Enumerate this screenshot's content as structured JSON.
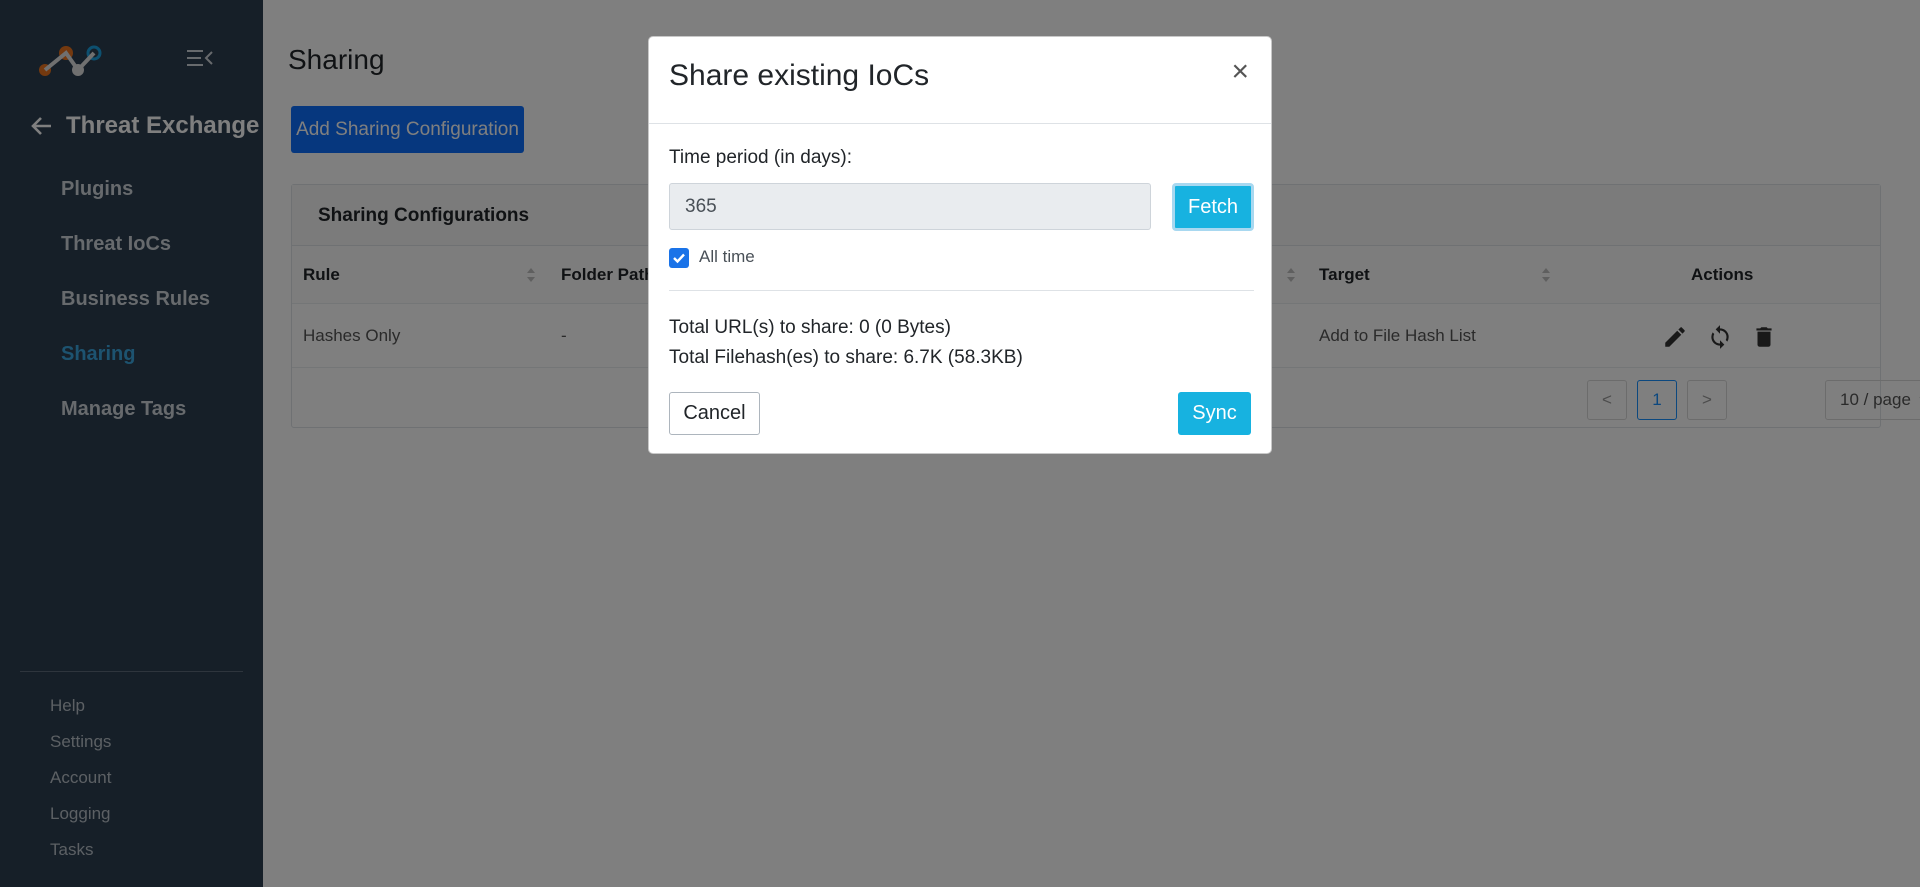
{
  "sidebar": {
    "module_title": "Threat Exchange",
    "nav_items": [
      {
        "label": "Plugins"
      },
      {
        "label": "Threat IoCs"
      },
      {
        "label": "Business Rules"
      },
      {
        "label": "Sharing",
        "active": true
      },
      {
        "label": "Manage Tags"
      }
    ],
    "footer_items": [
      {
        "label": "Help"
      },
      {
        "label": "Settings"
      },
      {
        "label": "Account"
      },
      {
        "label": "Logging"
      },
      {
        "label": "Tasks"
      }
    ]
  },
  "main": {
    "page_title": "Sharing",
    "add_button_label": "Add Sharing Configuration",
    "card_title": "Sharing Configurations",
    "columns": [
      "Rule",
      "Folder Path",
      "",
      "Target",
      "Actions"
    ],
    "rows": [
      {
        "rule": "Hashes Only",
        "folder_path": "-",
        "target": "Add to File Hash List"
      }
    ],
    "pagination": {
      "prev": "<",
      "current_page": "1",
      "next": ">",
      "page_size": "10 / page"
    }
  },
  "modal": {
    "title": "Share existing IoCs",
    "close_label": "×",
    "time_period_label": "Time period (in days):",
    "time_period_value": "365",
    "fetch_label": "Fetch",
    "all_time_label": "All time",
    "all_time_checked": true,
    "total_urls": "Total URL(s) to share: 0 (0 Bytes)",
    "total_filehashes": "Total Filehash(es) to share: 6.7K (58.3KB)",
    "cancel_label": "Cancel",
    "sync_label": "Sync"
  },
  "colors": {
    "sidebar_bg": "#2c3e50",
    "primary": "#0d6efd",
    "info": "#17b2e0",
    "active_nav": "#3aa7e0"
  },
  "icons": [
    "logo-icon",
    "menu-collapse-icon",
    "arrow-left-icon",
    "sort-icon",
    "edit-icon",
    "sync-icon",
    "trash-icon",
    "chevron-down-icon",
    "check-icon"
  ]
}
